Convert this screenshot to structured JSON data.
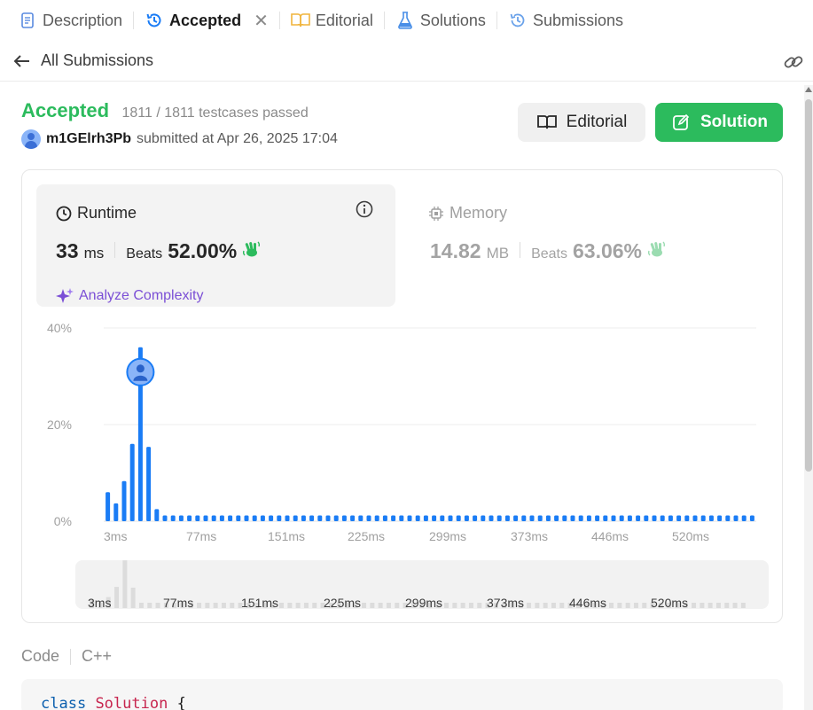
{
  "tabs": [
    {
      "label": "Description",
      "icon": "description-icon"
    },
    {
      "label": "Accepted",
      "icon": "history-icon",
      "active": true
    },
    {
      "label": "Editorial",
      "icon": "book-icon"
    },
    {
      "label": "Solutions",
      "icon": "flask-icon"
    },
    {
      "label": "Submissions",
      "icon": "history-icon"
    }
  ],
  "subheader": {
    "back_label": "All Submissions"
  },
  "submission": {
    "status": "Accepted",
    "testcases": "1811 / 1811 testcases passed",
    "username": "m1GElrh3Pb",
    "submitted_text": "submitted at Apr 26, 2025 17:04"
  },
  "buttons": {
    "editorial": "Editorial",
    "solution": "Solution"
  },
  "runtime": {
    "title": "Runtime",
    "value": "33",
    "unit": "ms",
    "beats_label": "Beats",
    "beats_value": "52.00%",
    "analyze": "Analyze Complexity"
  },
  "memory": {
    "title": "Memory",
    "value": "14.82",
    "unit": "MB",
    "beats_label": "Beats",
    "beats_value": "63.06%"
  },
  "colors": {
    "accent_green": "#2cbb5d",
    "bar_blue": "#1a7cf5",
    "purple": "#7b4fd6"
  },
  "chart_data": {
    "type": "bar",
    "title": "",
    "xlabel": "",
    "ylabel": "",
    "y_ticks": [
      "40%",
      "20%",
      "0%"
    ],
    "ylim": [
      0,
      40
    ],
    "x_ticks": [
      "3ms",
      "77ms",
      "151ms",
      "225ms",
      "299ms",
      "373ms",
      "446ms",
      "520ms"
    ],
    "values": [
      6,
      3.7,
      8.3,
      16,
      36,
      15.4,
      2.5,
      1.2,
      1.2,
      1.2,
      1.2,
      1.2,
      1.2,
      1.2,
      1.2,
      1.2,
      1.2,
      1.2,
      1.2,
      1.2,
      1.2,
      1.2,
      1.2,
      1.2,
      1.2,
      1.2,
      1.2,
      1.2,
      1.2,
      1.2,
      1.2,
      1.2,
      1.2,
      1.2,
      1.2,
      1.2,
      1.2,
      1.2,
      1.2,
      1.2,
      1.2,
      1.2,
      1.2,
      1.2,
      1.2,
      1.2,
      1.2,
      1.2,
      1.2,
      1.2,
      1.2,
      1.2,
      1.2,
      1.2,
      1.2,
      1.2,
      1.2,
      1.2,
      1.2,
      1.2,
      1.2,
      1.2,
      1.2,
      1.2,
      1.2,
      1.2,
      1.2,
      1.2,
      1.2,
      1.2,
      1.2,
      1.2,
      1.2,
      1.2,
      1.2,
      1.2,
      1.2,
      1.2,
      1.2,
      1.2
    ],
    "highlight_index": 4,
    "grid": true
  },
  "code": {
    "header_label": "Code",
    "language": "C++",
    "first_line_keyword": "class",
    "first_line_name": "Solution",
    "first_line_rest": " {"
  }
}
